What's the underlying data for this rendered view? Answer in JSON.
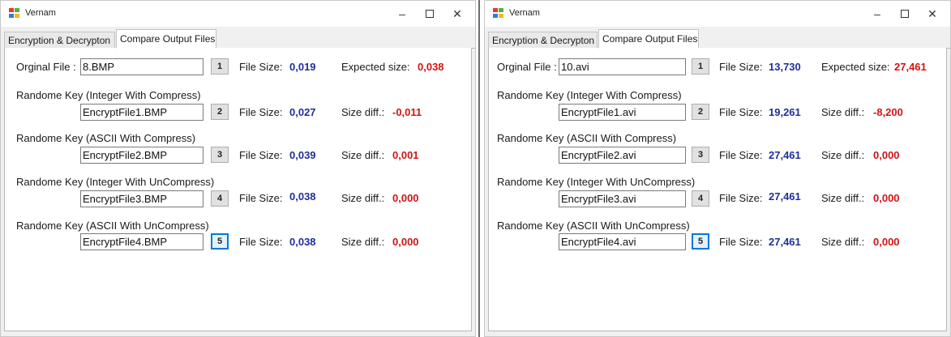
{
  "left": {
    "title": "Vernam",
    "tabs": [
      "Encryption & Decrypton",
      "Compare Output Files"
    ],
    "original_label": "Orginal File :",
    "original_file": "8.BMP",
    "original_btn": "1",
    "file_size_label": "File Size:",
    "original_size": "0,019",
    "expected_label": "Expected size:",
    "expected_size": "0,038",
    "rows": [
      {
        "heading": "Randome Key (Integer With Compress)",
        "file": "EncryptFile1.BMP",
        "btn": "2",
        "size": "0,027",
        "diff_label": "Size diff.:",
        "diff": "-0,011"
      },
      {
        "heading": "Randome Key (ASCII With Compress)",
        "file": "EncryptFile2.BMP",
        "btn": "3",
        "size": "0,039",
        "diff_label": "Size diff.:",
        "diff": "0,001"
      },
      {
        "heading": "Randome Key (Integer With UnCompress)",
        "file": "EncryptFile3.BMP",
        "btn": "4",
        "size": "0,038",
        "diff_label": "Size diff.:",
        "diff": "0,000"
      },
      {
        "heading": "Randome Key (ASCII With UnCompress)",
        "file": "EncryptFile4.BMP",
        "btn": "5",
        "size": "0,038",
        "diff_label": "Size diff.:",
        "diff": "0,000"
      }
    ]
  },
  "right": {
    "title": "Vernam",
    "tabs": [
      "Encryption & Decrypton",
      "Compare Output Files"
    ],
    "original_label": "Orginal File :",
    "original_file": "10.avi",
    "original_btn": "1",
    "file_size_label": "File Size:",
    "original_size": "13,730",
    "expected_label": "Expected size:",
    "expected_size": "27,461",
    "rows": [
      {
        "heading": "Randome Key (Integer With Compress)",
        "file": "EncryptFile1.avi",
        "btn": "2",
        "size": "19,261",
        "diff_label": "Size diff.:",
        "diff": "-8,200"
      },
      {
        "heading": "Randome Key (ASCII With Compress)",
        "file": "EncryptFile2.avi",
        "btn": "3",
        "size": "27,461",
        "diff_label": "Size diff.:",
        "diff": "0,000"
      },
      {
        "heading": "Randome Key (Integer With UnCompress)",
        "file": "EncryptFile3.avi",
        "btn": "4",
        "size": "27,461",
        "diff_label": "Size diff.:",
        "diff": "0,000"
      },
      {
        "heading": "Randome Key (ASCII With UnCompress)",
        "file": "EncryptFile4.avi",
        "btn": "5",
        "size": "27,461",
        "diff_label": "Size diff.:",
        "diff": "0,000"
      }
    ]
  },
  "colors": {
    "size_value": "#1f2f99",
    "diff_value": "#d11414",
    "focus_border": "#0078d7"
  },
  "icons": {
    "app": "app-icon",
    "minimize": "minimize-icon",
    "maximize": "maximize-icon",
    "close": "close-icon"
  }
}
